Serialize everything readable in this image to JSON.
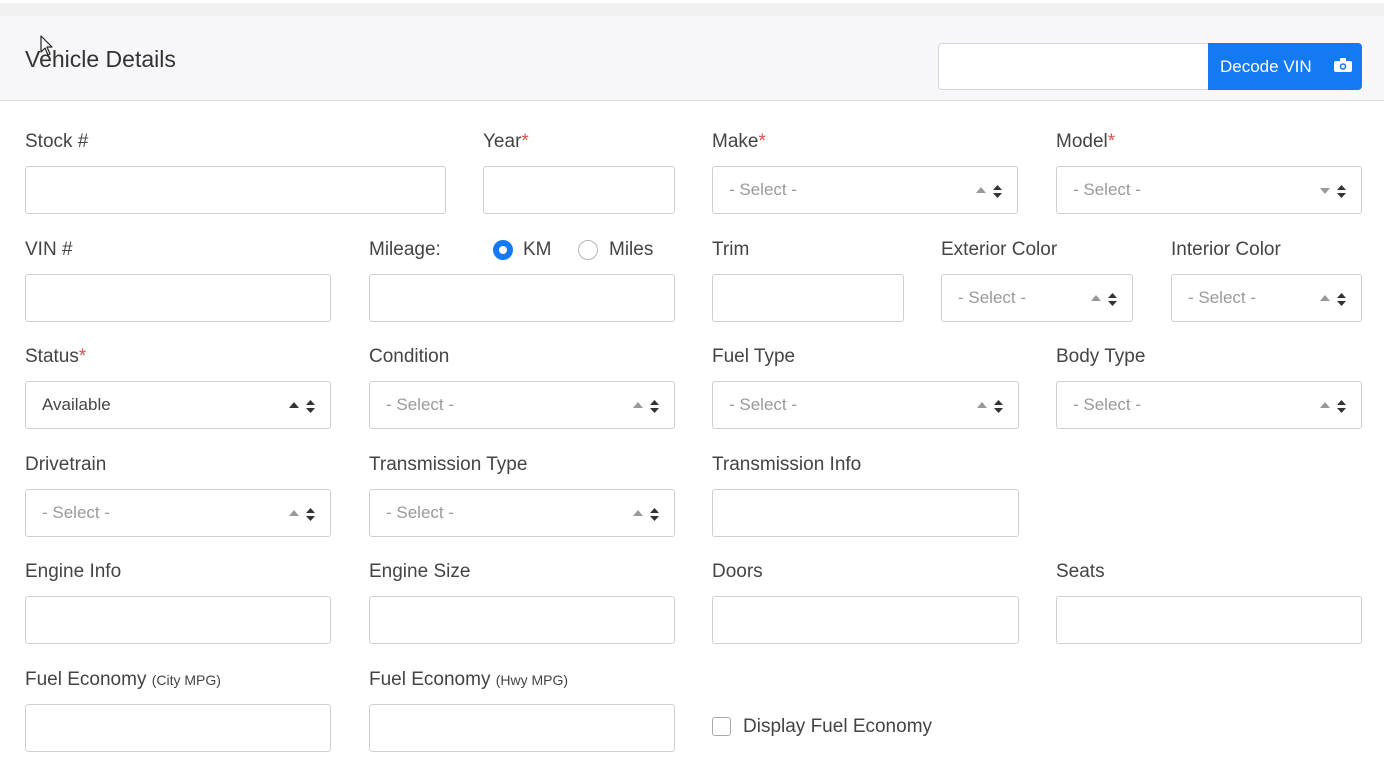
{
  "header": {
    "title": "Vehicle Details",
    "vin_input_value": "",
    "decode_button": "Decode VIN",
    "decode_icon": "camera-icon",
    "accent": "#1479f5"
  },
  "fields": {
    "stock": {
      "label": "Stock #",
      "value": ""
    },
    "year": {
      "label": "Year",
      "required": "*",
      "value": ""
    },
    "make": {
      "label": "Make",
      "required": "*",
      "selected": "- Select -"
    },
    "model": {
      "label": "Model",
      "required": "*",
      "selected": "- Select -"
    },
    "vin": {
      "label": "VIN #",
      "value": ""
    },
    "mileage": {
      "label": "Mileage:",
      "value": "",
      "unit_options": [
        "KM",
        "Miles"
      ],
      "unit_selected": "KM"
    },
    "trim": {
      "label": "Trim",
      "value": ""
    },
    "exterior_color": {
      "label": "Exterior Color",
      "selected": "- Select -"
    },
    "interior_color": {
      "label": "Interior Color",
      "selected": "- Select -"
    },
    "status": {
      "label": "Status",
      "required": "*",
      "selected": "Available"
    },
    "condition": {
      "label": "Condition",
      "selected": "- Select -"
    },
    "fuel_type": {
      "label": "Fuel Type",
      "selected": "- Select -"
    },
    "body_type": {
      "label": "Body Type",
      "selected": "- Select -"
    },
    "drivetrain": {
      "label": "Drivetrain",
      "selected": "- Select -"
    },
    "transmission_type": {
      "label": "Transmission Type",
      "selected": "- Select -"
    },
    "transmission_info": {
      "label": "Transmission Info",
      "value": ""
    },
    "engine_info": {
      "label": "Engine Info",
      "value": ""
    },
    "engine_size": {
      "label": "Engine Size",
      "value": ""
    },
    "doors": {
      "label": "Doors",
      "value": ""
    },
    "seats": {
      "label": "Seats",
      "value": ""
    },
    "fuel_city": {
      "label": "Fuel Economy",
      "sublabel": "(City MPG)",
      "value": ""
    },
    "fuel_hwy": {
      "label": "Fuel Economy",
      "sublabel": "(Hwy MPG)",
      "value": ""
    },
    "display_fuel_economy": {
      "label": "Display Fuel Economy",
      "checked": false
    }
  }
}
